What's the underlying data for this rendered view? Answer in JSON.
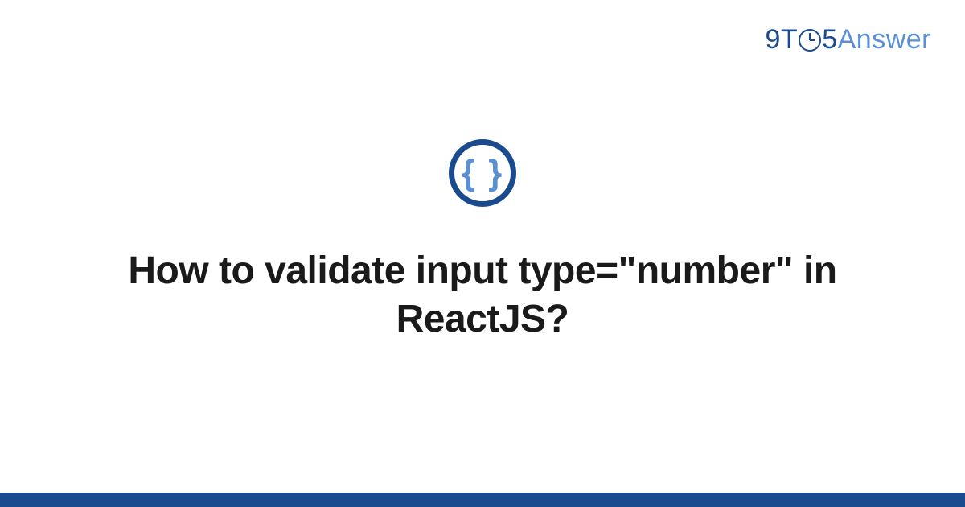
{
  "logo": {
    "part1": "9T",
    "part2": "5",
    "part3": "Answer"
  },
  "icon": {
    "braces": "{ }"
  },
  "question": {
    "title": "How to validate input type=\"number\" in ReactJS?"
  },
  "colors": {
    "brand_dark": "#1a4b8e",
    "brand_light": "#5a8fd4"
  }
}
